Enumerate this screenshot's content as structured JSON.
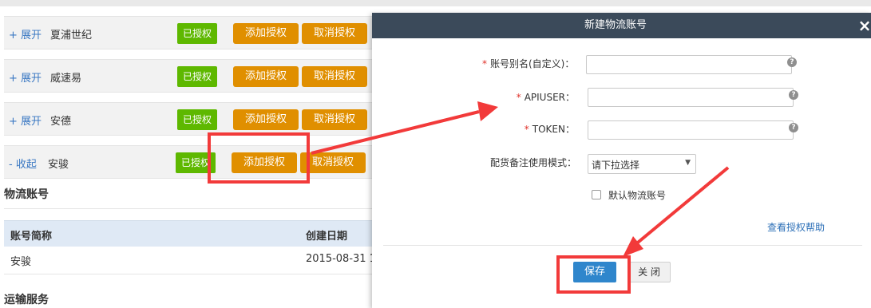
{
  "carriers": [
    {
      "toggle": "+ 展开",
      "name": "夏浦世纪",
      "status": "已授权",
      "add_label": "添加授权",
      "cancel_label": "取消授权"
    },
    {
      "toggle": "+ 展开",
      "name": "威速易",
      "status": "已授权",
      "add_label": "添加授权",
      "cancel_label": "取消授权"
    },
    {
      "toggle": "+ 展开",
      "name": "安德",
      "status": "已授权",
      "add_label": "添加授权",
      "cancel_label": "取消授权"
    },
    {
      "toggle": "- 收起",
      "name": "安骏",
      "status": "已授权",
      "add_label": "添加授权",
      "cancel_label": "取消授权"
    }
  ],
  "logistics_section": {
    "title": "物流账号",
    "columns": [
      "账号简称",
      "创建日期"
    ],
    "rows": [
      [
        "安骏",
        "2015-08-31 1"
      ]
    ]
  },
  "transport_section": {
    "title": "运输服务"
  },
  "modal": {
    "title": "新建物流账号",
    "close_icon": "×",
    "fields": [
      {
        "required_mark": "*",
        "label": "账号别名(自定义)：",
        "value": ""
      },
      {
        "required_mark": "*",
        "label": "APIUSER：",
        "value": ""
      },
      {
        "required_mark": "*",
        "label": "TOKEN：",
        "value": ""
      }
    ],
    "mode_label": "配货备注使用模式：",
    "mode_select": "请下拉选择",
    "default_checkbox_label": "默认物流账号",
    "help_icon": "?",
    "help_link": "查看授权帮助",
    "save_label": "保存",
    "close_label": "关 闭"
  },
  "colors": {
    "header_bg": "#3b4a5a",
    "authorized_green": "#5eb800",
    "action_orange": "#e08f00",
    "save_blue": "#2f86cc",
    "annotation_red": "#f23a3a"
  }
}
